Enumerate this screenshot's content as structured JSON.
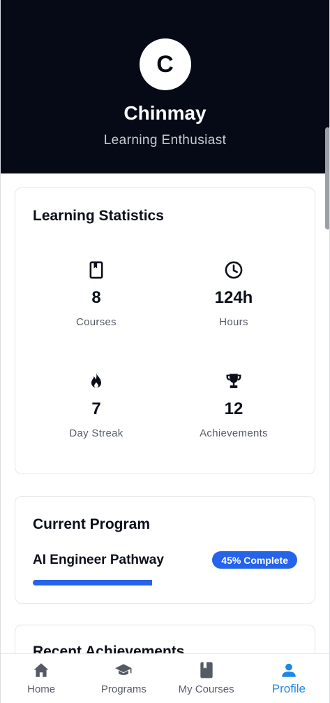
{
  "profile": {
    "initial": "C",
    "name": "Chinmay",
    "role": "Learning Enthusiast"
  },
  "stats": {
    "title": "Learning Statistics",
    "items": [
      {
        "icon": "book-icon",
        "value": "8",
        "label": "Courses"
      },
      {
        "icon": "clock-icon",
        "value": "124h",
        "label": "Hours"
      },
      {
        "icon": "flame-icon",
        "value": "7",
        "label": "Day Streak"
      },
      {
        "icon": "trophy-icon",
        "value": "12",
        "label": "Achievements"
      }
    ]
  },
  "program": {
    "title": "Current Program",
    "name": "AI Engineer Pathway",
    "badge": "45% Complete",
    "progress": 0.45
  },
  "achievements": {
    "title": "Recent Achievements"
  },
  "tabs": [
    {
      "icon": "home-icon",
      "label": "Home",
      "active": false
    },
    {
      "icon": "graduation-cap-icon",
      "label": "Programs",
      "active": false
    },
    {
      "icon": "book-icon",
      "label": "My Courses",
      "active": false
    },
    {
      "icon": "person-icon",
      "label": "Profile",
      "active": true
    }
  ],
  "colors": {
    "header_bg": "#050a16",
    "accent": "#2563eb",
    "active_tab": "#1e88e5"
  }
}
